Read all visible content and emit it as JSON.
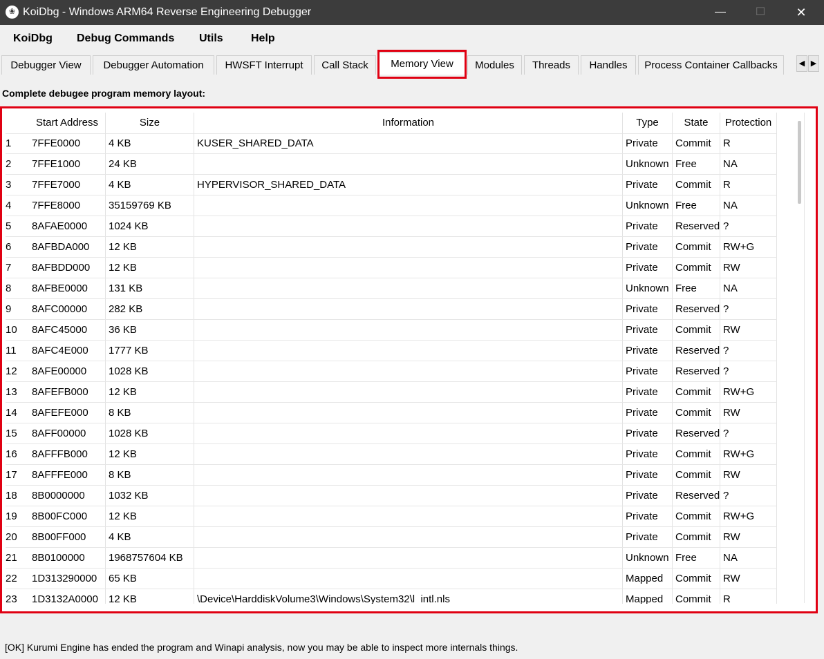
{
  "window": {
    "title": "KoiDbg - Windows ARM64 Reverse Engineering Debugger",
    "icon": "koi-fish-icon",
    "controls": {
      "minimize": "—",
      "maximize": "☐",
      "close": "✕"
    }
  },
  "menu": {
    "items": [
      "KoiDbg",
      "Debug Commands",
      "Utils",
      "Help"
    ]
  },
  "tabs": {
    "items": [
      "Debugger View",
      "Debugger Automation",
      "HWSFT Interrupt",
      "Call Stack",
      "Memory View",
      "Modules",
      "Threads",
      "Handles",
      "Process Container Callbacks"
    ],
    "active": "Memory View",
    "scroll_left": "◀",
    "scroll_right": "▶"
  },
  "section_label": "Complete debugee program memory layout:",
  "table": {
    "columns": [
      "Start Address",
      "Size",
      "Information",
      "Type",
      "State",
      "Protection"
    ],
    "rows": [
      [
        "1",
        "7FFE0000",
        "4 KB",
        "KUSER_SHARED_DATA",
        "Private",
        "Commit",
        "R"
      ],
      [
        "2",
        "7FFE1000",
        "24 KB",
        "",
        "Unknown",
        "Free",
        "NA"
      ],
      [
        "3",
        "7FFE7000",
        "4 KB",
        "HYPERVISOR_SHARED_DATA",
        "Private",
        "Commit",
        "R"
      ],
      [
        "4",
        "7FFE8000",
        "35159769 KB",
        "",
        "Unknown",
        "Free",
        "NA"
      ],
      [
        "5",
        "8AFAE0000",
        "1024 KB",
        "",
        "Private",
        "Reserved",
        "?"
      ],
      [
        "6",
        "8AFBDA000",
        "12 KB",
        "",
        "Private",
        "Commit",
        "RW+G"
      ],
      [
        "7",
        "8AFBDD000",
        "12 KB",
        "",
        "Private",
        "Commit",
        "RW"
      ],
      [
        "8",
        "8AFBE0000",
        "131 KB",
        "",
        "Unknown",
        "Free",
        "NA"
      ],
      [
        "9",
        "8AFC00000",
        "282 KB",
        "",
        "Private",
        "Reserved",
        "?"
      ],
      [
        "10",
        "8AFC45000",
        "36 KB",
        "",
        "Private",
        "Commit",
        "RW"
      ],
      [
        "11",
        "8AFC4E000",
        "1777 KB",
        "",
        "Private",
        "Reserved",
        "?"
      ],
      [
        "12",
        "8AFE00000",
        "1028 KB",
        "",
        "Private",
        "Reserved",
        "?"
      ],
      [
        "13",
        "8AFEFB000",
        "12 KB",
        "",
        "Private",
        "Commit",
        "RW+G"
      ],
      [
        "14",
        "8AFEFE000",
        "8 KB",
        "",
        "Private",
        "Commit",
        "RW"
      ],
      [
        "15",
        "8AFF00000",
        "1028 KB",
        "",
        "Private",
        "Reserved",
        "?"
      ],
      [
        "16",
        "8AFFFB000",
        "12 KB",
        "",
        "Private",
        "Commit",
        "RW+G"
      ],
      [
        "17",
        "8AFFFE000",
        "8 KB",
        "",
        "Private",
        "Commit",
        "RW"
      ],
      [
        "18",
        "8B0000000",
        "1032 KB",
        "",
        "Private",
        "Reserved",
        "?"
      ],
      [
        "19",
        "8B00FC000",
        "12 KB",
        "",
        "Private",
        "Commit",
        "RW+G"
      ],
      [
        "20",
        "8B00FF000",
        "4 KB",
        "",
        "Private",
        "Commit",
        "RW"
      ],
      [
        "21",
        "8B0100000",
        "1968757604 KB",
        "",
        "Unknown",
        "Free",
        "NA"
      ],
      [
        "22",
        "1D313290000",
        "65 KB",
        "",
        "Mapped",
        "Commit",
        "RW"
      ],
      [
        "23",
        "1D3132A0000",
        "12 KB",
        "\\Device\\HarddiskVolume3\\Windows\\System32\\l_intl.nls",
        "Mapped",
        "Commit",
        "R"
      ]
    ]
  },
  "status": "[OK] Kurumi Engine has ended the program and Winapi analysis, now you may be able to inspect more internals things.",
  "colors": {
    "highlight": "#e00012",
    "titlebar": "#3c3c3c"
  }
}
